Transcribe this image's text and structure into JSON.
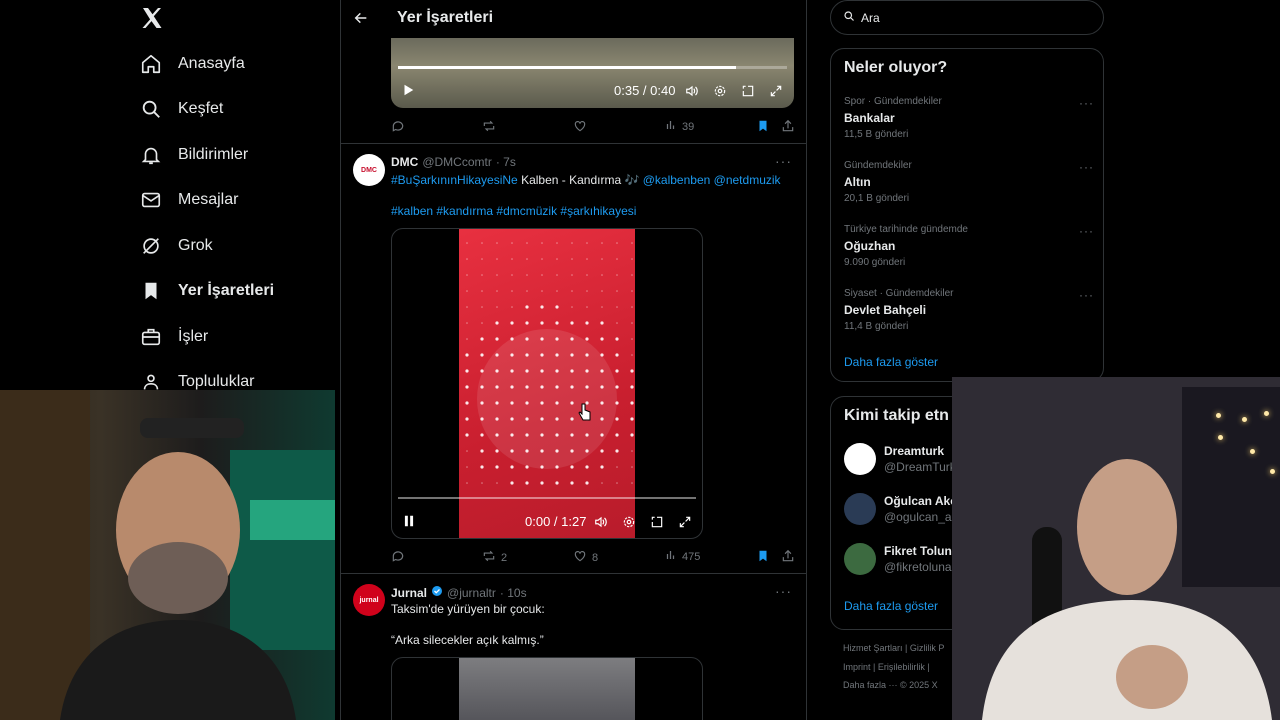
{
  "nav": {
    "logo": "X",
    "items": [
      {
        "label": "Anasayfa",
        "icon": "home-icon"
      },
      {
        "label": "Keşfet",
        "icon": "search-icon"
      },
      {
        "label": "Bildirimler",
        "icon": "bell-icon"
      },
      {
        "label": "Mesajlar",
        "icon": "mail-icon"
      },
      {
        "label": "Grok",
        "icon": "grok-icon"
      },
      {
        "label": "Yer İşaretleri",
        "icon": "bookmark-icon"
      },
      {
        "label": "İşler",
        "icon": "briefcase-icon"
      },
      {
        "label": "Topluluklar",
        "icon": "people-icon"
      }
    ]
  },
  "header": {
    "title": "Yer İşaretleri"
  },
  "tweet1": {
    "video_time": "0:35 / 0:40",
    "progress": 0.87,
    "views": "39"
  },
  "tweet2": {
    "avatar_text": "DMC",
    "name": "DMC",
    "handle": "@DMCcomtr",
    "time": "· 7s",
    "hashtag1": "#BuŞarkınınHikayesiNe",
    "text": " Kalben - Kandırma 🎶 ",
    "mention1": "@kalbenben",
    "mention2": "@netdmuzik",
    "hashtags2": "#kalben #kandırma #dmcmüzik #şarkıhikayesi",
    "video_time": "0:00 / 1:27",
    "progress": 0.0,
    "retweets": "2",
    "likes": "8",
    "views": "475"
  },
  "tweet3": {
    "avatar_text": "jurnal",
    "name": "Jurnal",
    "handle": "@jurnaltr",
    "time": "· 10s",
    "line1": "Taksim'de yürüyen bir çocuk:",
    "line2": "“Arka silecekler açık kalmış.”"
  },
  "search": {
    "value": "Ara"
  },
  "trends": {
    "title": "Neler oluyor?",
    "items": [
      {
        "meta": "Spor · Gündemdekiler",
        "topic": "Bankalar",
        "count": "11,5 B gönderi"
      },
      {
        "meta": "Gündemdekiler",
        "topic": "Altın",
        "count": "20,1 B gönderi"
      },
      {
        "meta": "Türkiye tarihinde gündemde",
        "topic": "Oğuzhan",
        "count": "9.090 gönderi"
      },
      {
        "meta": "Siyaset · Gündemdekiler",
        "topic": "Devlet Bahçeli",
        "count": "11,4 B gönderi"
      }
    ],
    "show_more": "Daha fazla göster"
  },
  "who_to_follow": {
    "title": "Kimi takip etn",
    "items": [
      {
        "name": "Dreamturk",
        "handle": "@DreamTurk"
      },
      {
        "name": "Oğulcan Akç",
        "handle": "@ogulcan_ak"
      },
      {
        "name": "Fikret Toluna",
        "handle": "@fikretoluna"
      }
    ],
    "show_more": "Daha fazla göster"
  },
  "footer": {
    "line1": "Hizmet Şartları  |  Gizlilik P",
    "line2": "Imprint  |  Erişilebilirlik  |",
    "line3": "Daha fazla ···  © 2025 X"
  },
  "colors": {
    "accent": "#1d9bf0",
    "border": "#2f3336",
    "muted": "#71767b",
    "video_red": "#d42535"
  }
}
